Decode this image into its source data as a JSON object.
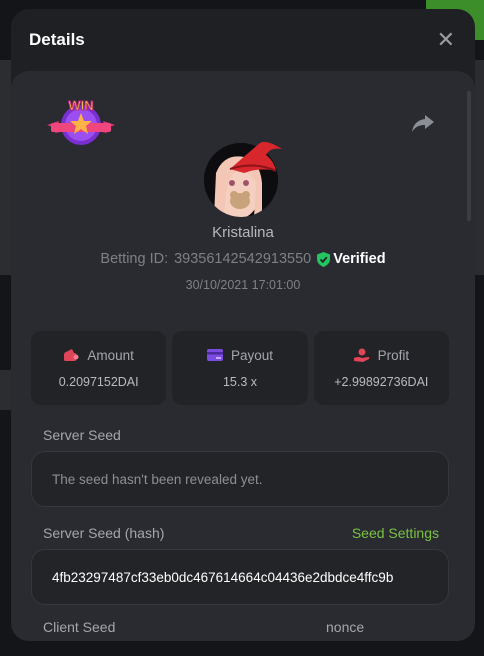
{
  "modal": {
    "title": "Details"
  },
  "bet": {
    "username": "Kristalina",
    "betting_id_label": "Betting ID:",
    "betting_id": "39356142542913550",
    "verified_label": "Verified",
    "date": "30/10/2021 17:01:00"
  },
  "badge": {
    "text": "WIN"
  },
  "stats": {
    "amount": {
      "label": "Amount",
      "value": "0.2097152DAI"
    },
    "payout": {
      "label": "Payout",
      "value": "15.3 x"
    },
    "profit": {
      "label": "Profit",
      "value": "+2.99892736DAI"
    }
  },
  "server_seed": {
    "label": "Server Seed",
    "value": "The seed hasn't been revealed yet."
  },
  "server_seed_hash": {
    "label": "Server Seed (hash)",
    "link": "Seed Settings",
    "value": "4fb23297487cf33eb0dc467614664c04436e2dbdce4ffc9b"
  },
  "client_seed": {
    "label": "Client Seed"
  },
  "nonce": {
    "label": "nonce"
  },
  "colors": {
    "accent_green": "#7ac142",
    "verified_green": "#22c55e",
    "amount_icon": "#e0455a",
    "payout_icon": "#7c4ce0",
    "profit_icon": "#e0455a"
  }
}
